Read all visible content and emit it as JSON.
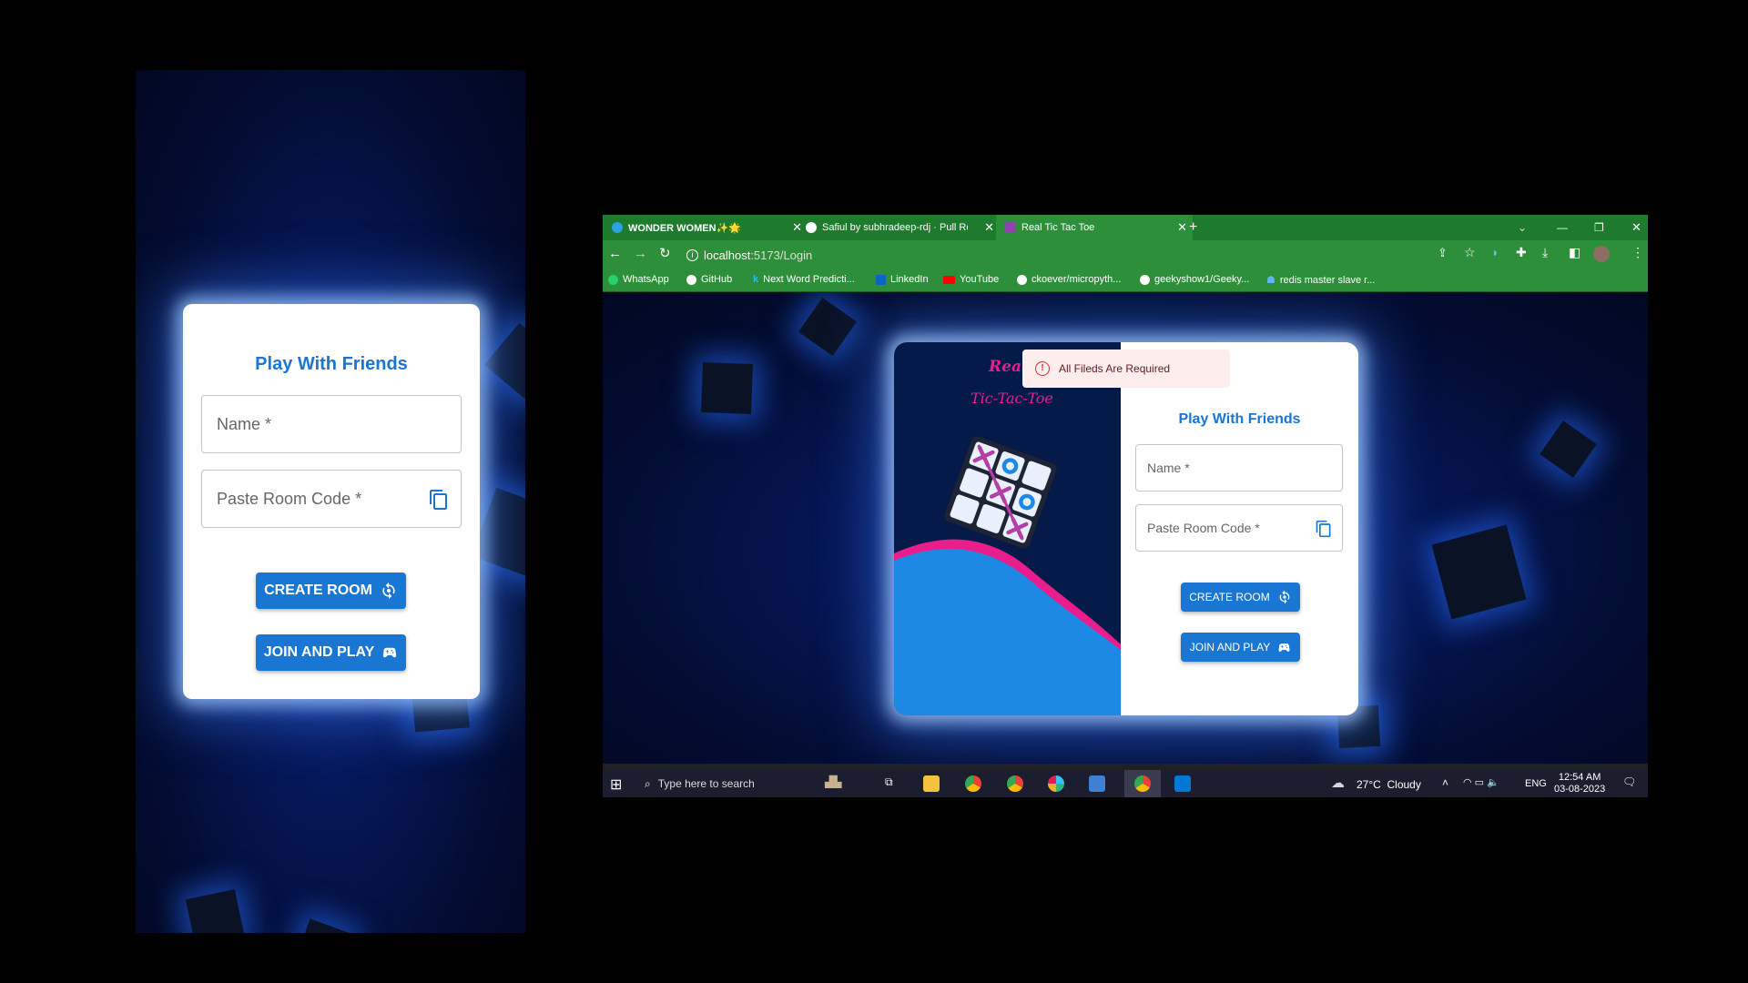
{
  "mobile": {
    "title": "Play With Friends",
    "name_label": "Name *",
    "room_label": "Paste Room Code *",
    "create_label": "CREATE ROOM",
    "join_label": "JOIN AND PLAY"
  },
  "browser": {
    "tabs": [
      {
        "label": "WONDER WOMEN✨🌟",
        "active": false
      },
      {
        "label": "Safiul by subhradeep-rdj · Pull Re",
        "active": false
      },
      {
        "label": "Real Tic Tac Toe",
        "active": true
      }
    ],
    "address": {
      "host": "localhost",
      "path": ":5173/Login"
    },
    "bookmarks": [
      "WhatsApp",
      "GitHub",
      "Next Word Predicti...",
      "LinkedIn",
      "YouTube",
      "ckoever/micropyth...",
      "geekyshow1/Geeky...",
      "redis master slave r..."
    ],
    "page": {
      "logo_line1": "Real",
      "logo_line2": "Tic-Tac-Toe",
      "alert": "All Fileds Are Required",
      "title": "Play With Friends",
      "name_label": "Name *",
      "room_label": "Paste Room Code *",
      "create_label": "CREATE ROOM",
      "join_label": "JOIN AND PLAY"
    },
    "taskbar": {
      "search_placeholder": "Type here to search",
      "weather": "27°C  Cloudy",
      "lang": "ENG",
      "time": "12:54 AM",
      "date": "03-08-2023"
    }
  },
  "colors": {
    "accent": "#1976d2",
    "browser_chrome": "#2e8f3a",
    "alert_bg": "#fdeded",
    "alert_text": "#5f2120",
    "pink": "#e91e8c"
  }
}
